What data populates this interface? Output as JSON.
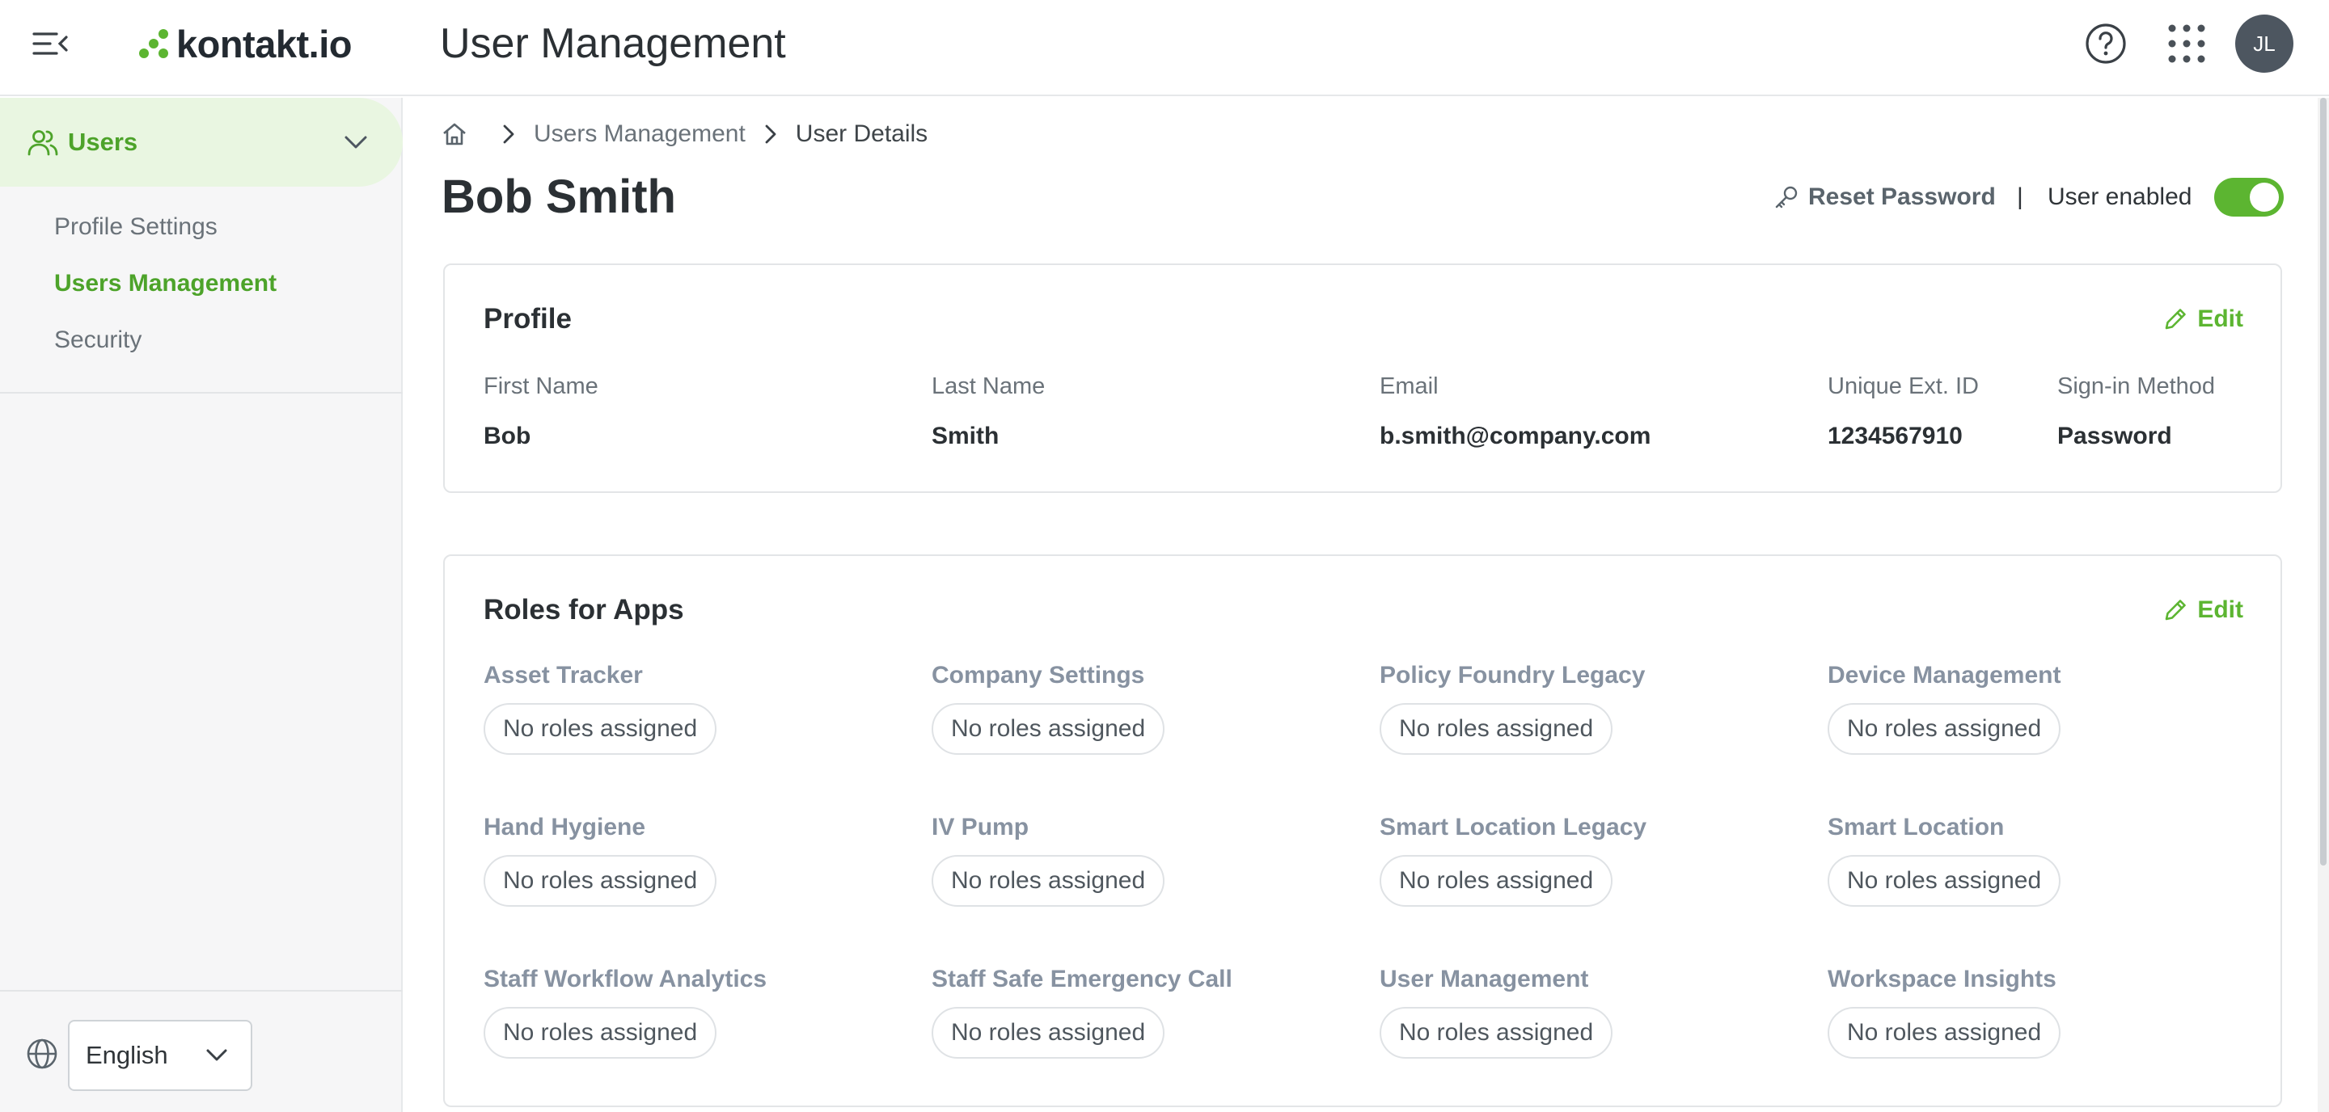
{
  "header": {
    "brand": "kontakt.io",
    "app_title": "User Management",
    "avatar_initials": "JL"
  },
  "sidebar": {
    "group_label": "Users",
    "items": [
      {
        "label": "Profile Settings",
        "active": false
      },
      {
        "label": "Users Management",
        "active": true
      },
      {
        "label": "Security",
        "active": false
      }
    ],
    "language": "English"
  },
  "breadcrumb": {
    "items": [
      "Users Management",
      "User Details"
    ]
  },
  "page": {
    "title": "Bob Smith",
    "reset_password_label": "Reset Password",
    "separator": "|",
    "user_enabled_label": "User enabled",
    "user_enabled": true
  },
  "profile": {
    "title": "Profile",
    "edit_label": "Edit",
    "fields": [
      {
        "label": "First Name",
        "value": "Bob"
      },
      {
        "label": "Last Name",
        "value": "Smith"
      },
      {
        "label": "Email",
        "value": "b.smith@company.com"
      },
      {
        "label": "Unique Ext. ID",
        "value": "1234567910"
      },
      {
        "label": "Sign-in Method",
        "value": "Password"
      }
    ]
  },
  "roles": {
    "title": "Roles for Apps",
    "edit_label": "Edit",
    "apps": [
      {
        "name": "Asset Tracker",
        "status": "No roles assigned"
      },
      {
        "name": "Company Settings",
        "status": "No roles assigned"
      },
      {
        "name": "Policy Foundry Legacy",
        "status": "No roles assigned"
      },
      {
        "name": "Device Management",
        "status": "No roles assigned"
      },
      {
        "name": "Hand Hygiene",
        "status": "No roles assigned"
      },
      {
        "name": "IV Pump",
        "status": "No roles assigned"
      },
      {
        "name": "Smart Location Legacy",
        "status": "No roles assigned"
      },
      {
        "name": "Smart Location",
        "status": "No roles assigned"
      },
      {
        "name": "Staff Workflow Analytics",
        "status": "No roles assigned"
      },
      {
        "name": "Staff Safe Emergency Call",
        "status": "No roles assigned"
      },
      {
        "name": "User Management",
        "status": "No roles assigned"
      },
      {
        "name": "Workspace Insights",
        "status": "No roles assigned"
      }
    ]
  },
  "colors": {
    "accent_green": "#5cb531",
    "sidebar_active_bg": "#e9f6e1",
    "text_dark": "#2b3034",
    "text_muted": "#6a7279"
  },
  "icons": {
    "menu": "menu-collapse-icon",
    "help": "help-circle-icon",
    "apps": "apps-grid-icon",
    "users": "users-icon",
    "home": "home-icon",
    "key": "key-icon",
    "pencil": "pencil-icon",
    "globe": "globe-icon",
    "chevron": "chevron-down-icon"
  }
}
